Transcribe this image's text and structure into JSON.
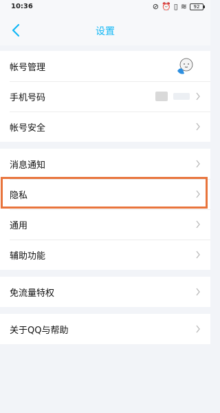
{
  "status_bar": {
    "time": "10:36",
    "battery": "92"
  },
  "nav": {
    "title": "设置"
  },
  "groups": [
    {
      "items": [
        {
          "label": "帐号管理"
        },
        {
          "label": "手机号码"
        },
        {
          "label": "帐号安全"
        }
      ]
    },
    {
      "items": [
        {
          "label": "消息通知"
        },
        {
          "label": "隐私"
        },
        {
          "label": "通用"
        },
        {
          "label": "辅助功能"
        }
      ]
    },
    {
      "items": [
        {
          "label": "免流量特权"
        }
      ]
    },
    {
      "items": [
        {
          "label": "关于QQ与帮助"
        }
      ]
    }
  ],
  "accent_color": "#12b7f5",
  "highlight_color": "#e8743c"
}
